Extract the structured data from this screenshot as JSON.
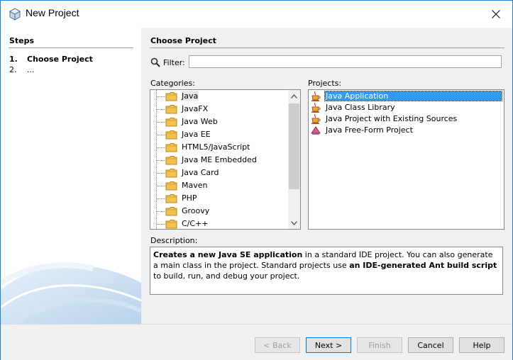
{
  "window": {
    "title": "New Project",
    "close_icon": "close-icon",
    "app_icon": "netbeans-cube-icon"
  },
  "steps": {
    "heading": "Steps",
    "items": [
      {
        "num": "1.",
        "label": "Choose Project"
      },
      {
        "num": "2.",
        "label": "..."
      }
    ]
  },
  "main": {
    "heading": "Choose Project",
    "filter_label": "Filter:",
    "filter_value": "",
    "categories_label": "Categories:",
    "projects_label": "Projects:",
    "categories": [
      "Java",
      "JavaFX",
      "Java Web",
      "Java EE",
      "HTML5/JavaScript",
      "Java ME Embedded",
      "Java Card",
      "Maven",
      "PHP",
      "Groovy",
      "C/C++"
    ],
    "selected_category": "Java",
    "projects": [
      "Java Application",
      "Java Class Library",
      "Java Project with Existing Sources",
      "Java Free-Form Project"
    ],
    "selected_project": "Java Application",
    "description_label": "Description:",
    "description": {
      "p1_bold": "Creates a new Java SE application",
      "p1_rest": " in a standard IDE project. You can also generate a main class in the project. Standard projects use ",
      "p2_bold": "an IDE-generated Ant build script",
      "p2_rest": " to build, run, and debug your project."
    }
  },
  "buttons": {
    "back": "< Back",
    "next": "Next >",
    "finish": "Finish",
    "cancel": "Cancel",
    "help": "Help"
  },
  "colors": {
    "accent": "#1883d7",
    "selection": "#3399ff"
  }
}
